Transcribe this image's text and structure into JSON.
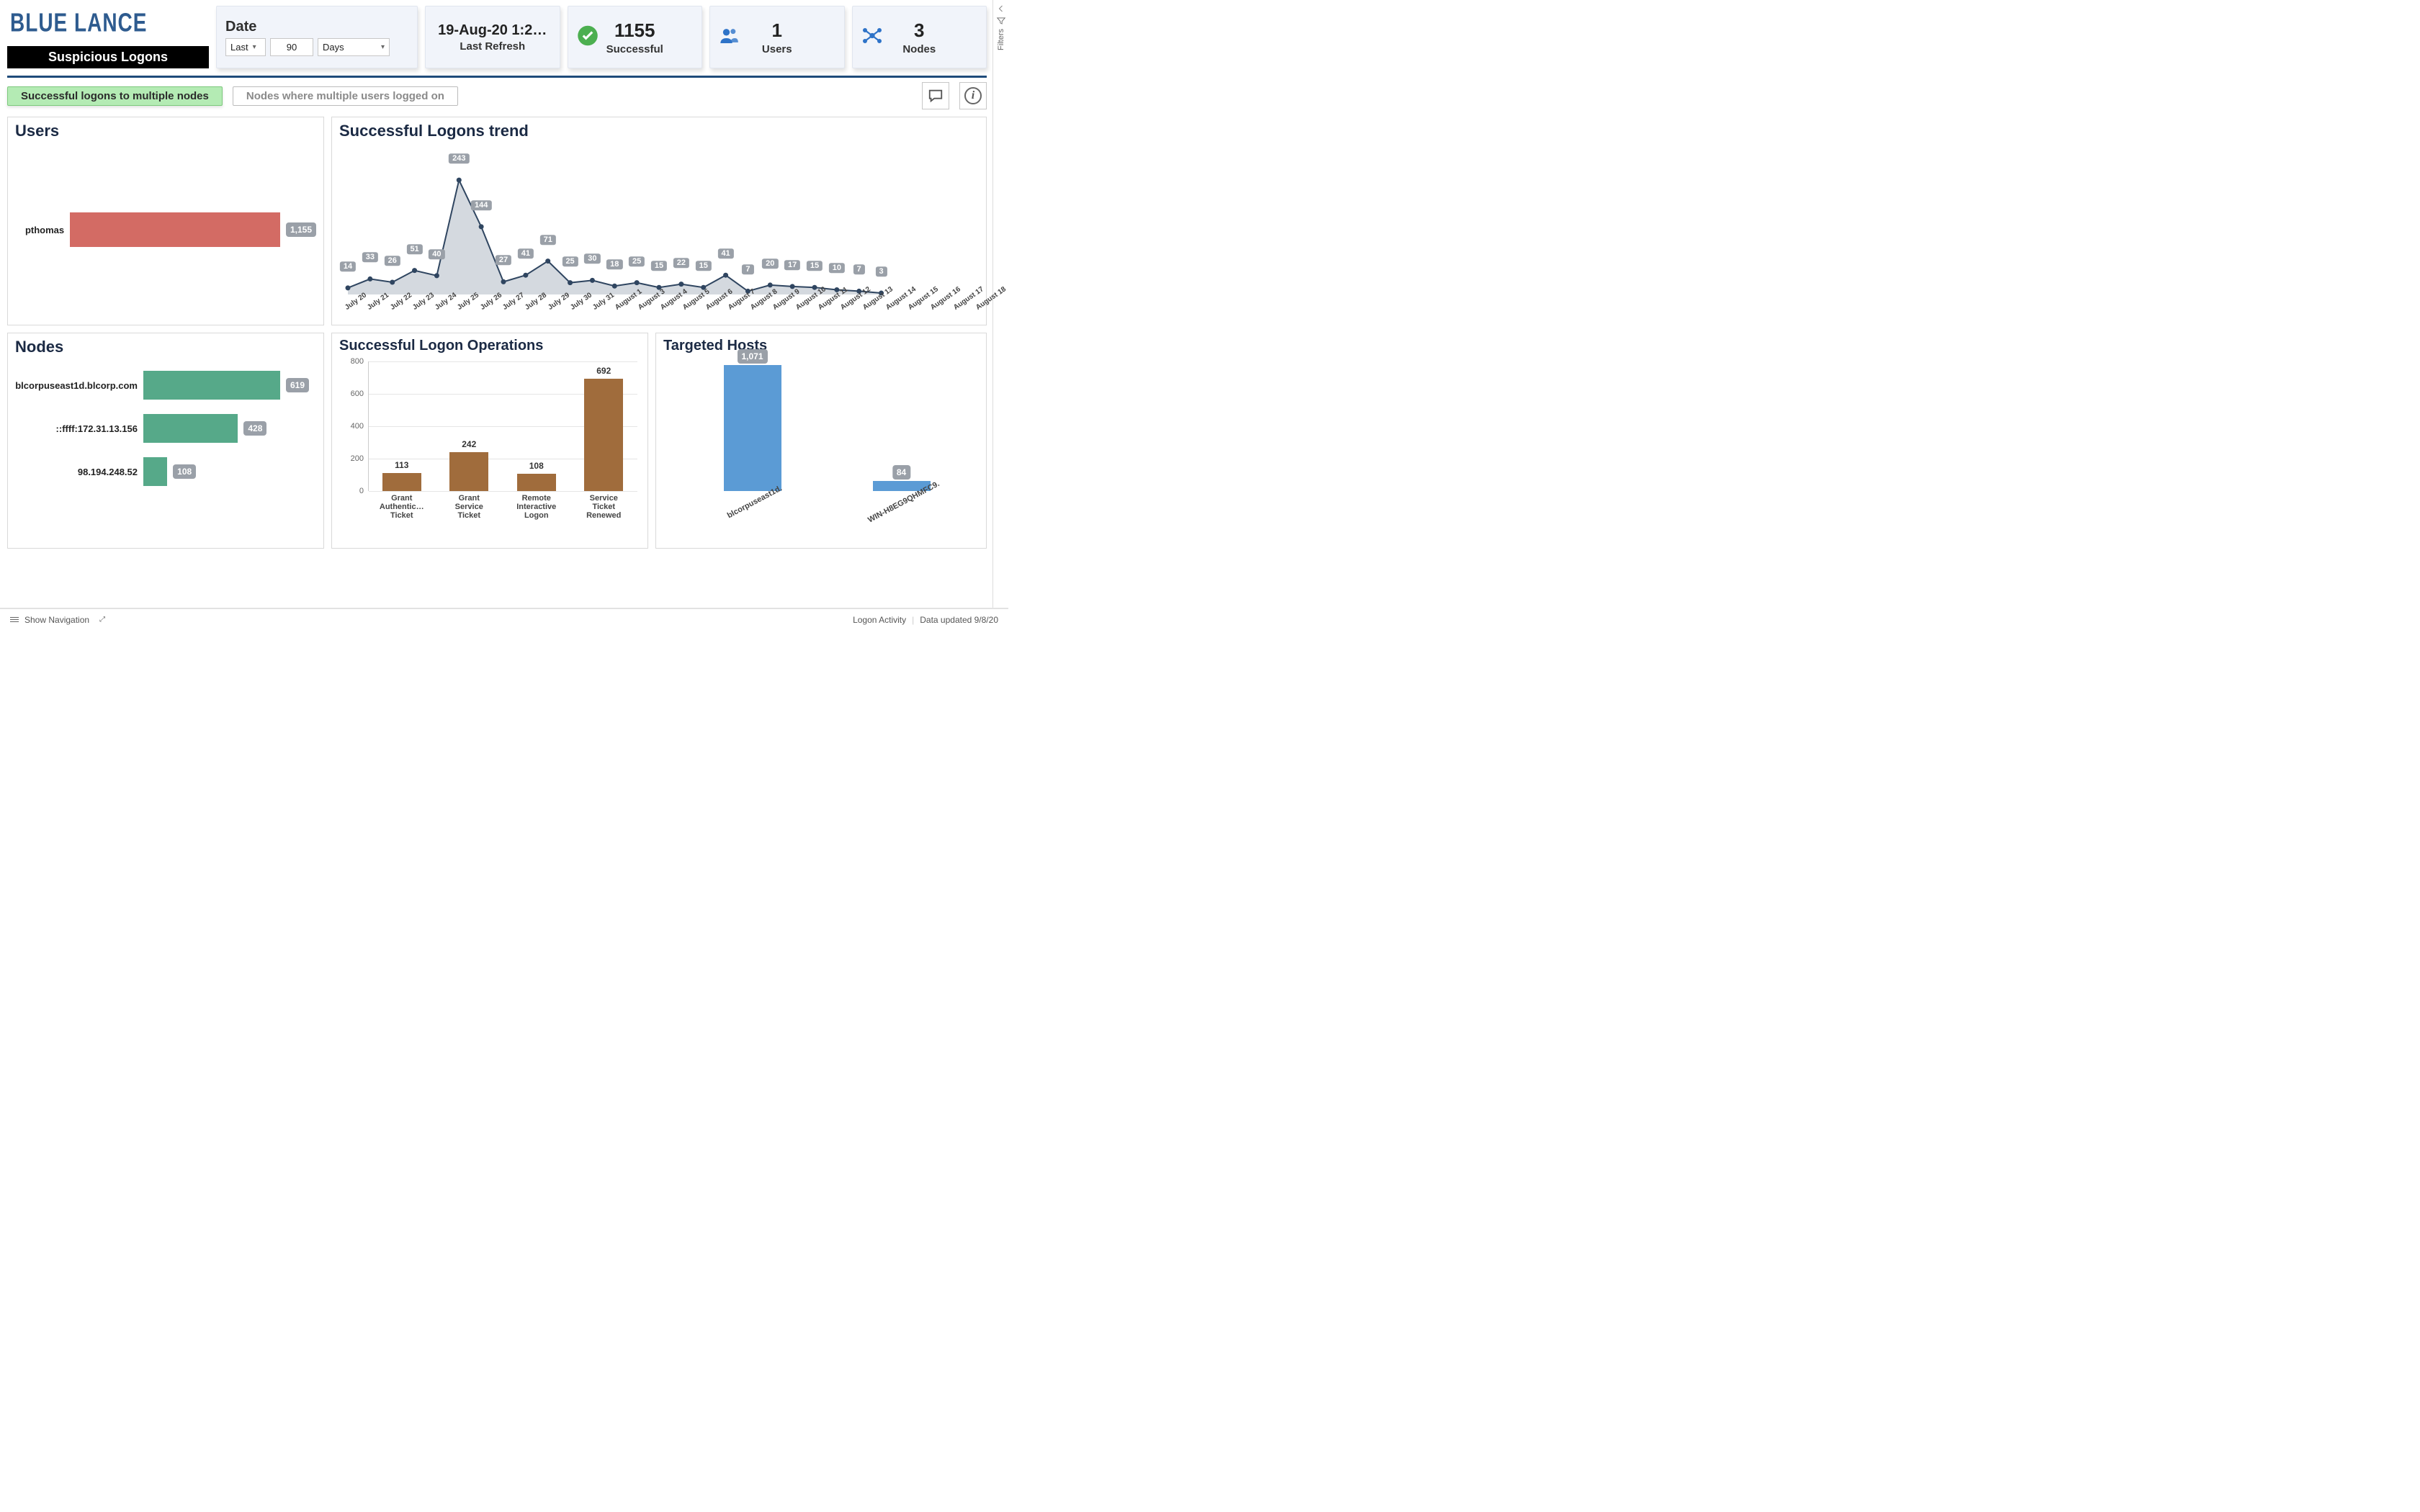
{
  "header": {
    "brand": "BLUE LANCE",
    "subtitle": "Suspicious Logons",
    "date_label": "Date",
    "range_mode": "Last",
    "range_value": "90",
    "range_unit": "Days",
    "refresh_value": "19-Aug-20 1:2…",
    "refresh_label": "Last Refresh",
    "kpi_success": {
      "value": "1155",
      "label": "Successful"
    },
    "kpi_users": {
      "value": "1",
      "label": "Users"
    },
    "kpi_nodes": {
      "value": "3",
      "label": "Nodes"
    }
  },
  "tabs": {
    "active": "Successful logons to multiple nodes",
    "inactive": "Nodes where multiple users logged on"
  },
  "panels": {
    "users_title": "Users",
    "nodes_title": "Nodes",
    "trend_title": "Successful Logons trend",
    "ops_title": "Successful Logon Operations",
    "hosts_title": "Targeted Hosts"
  },
  "filters_label": "Filters",
  "footer": {
    "show_nav": "Show Navigation",
    "right1": "Logon Activity",
    "right2": "Data updated 9/8/20"
  },
  "chart_data": [
    {
      "id": "users",
      "type": "bar",
      "orientation": "horizontal",
      "categories": [
        "pthomas"
      ],
      "values": [
        1155
      ],
      "value_labels": [
        "1,155"
      ],
      "color": "#d36b64"
    },
    {
      "id": "nodes",
      "type": "bar",
      "orientation": "horizontal",
      "categories": [
        "blcorpuseast1d.blcorp.com",
        "::ffff:172.31.13.156",
        "98.194.248.52"
      ],
      "values": [
        619,
        428,
        108
      ],
      "color": "#56a989"
    },
    {
      "id": "trend",
      "type": "area",
      "categories": [
        "July 20",
        "July 21",
        "July 22",
        "July 23",
        "July 24",
        "July 25",
        "July 26",
        "July 27",
        "July 28",
        "July 29",
        "July 30",
        "July 31",
        "August 1",
        "August 3",
        "August 4",
        "August 5",
        "August 6",
        "August 7",
        "August 8",
        "August 9",
        "August 10",
        "August 11",
        "August 12",
        "August 13",
        "August 14",
        "August 15",
        "August 16",
        "August 17",
        "August 18"
      ],
      "values": [
        14,
        33,
        26,
        51,
        40,
        243,
        144,
        27,
        41,
        71,
        25,
        30,
        18,
        25,
        15,
        22,
        15,
        41,
        7,
        20,
        17,
        15,
        10,
        7,
        3,
        0,
        0,
        0,
        0
      ],
      "labeled_values": [
        14,
        33,
        26,
        51,
        40,
        243,
        144,
        27,
        41,
        71,
        25,
        30,
        18,
        25,
        15,
        22,
        15,
        41,
        7,
        20,
        17,
        15,
        10,
        7,
        3
      ],
      "ylim": [
        0,
        260
      ],
      "title": "Successful Logons trend"
    },
    {
      "id": "ops",
      "type": "bar",
      "categories": [
        "Grant Authentic… Ticket",
        "Grant Service Ticket",
        "Remote Interactive Logon",
        "Service Ticket Renewed"
      ],
      "values": [
        113,
        242,
        108,
        692
      ],
      "ylim": [
        0,
        800
      ],
      "yticks": [
        0,
        200,
        400,
        600,
        800
      ],
      "color": "#a06c3c",
      "title": "Successful Logon Operations"
    },
    {
      "id": "hosts",
      "type": "bar",
      "categories": [
        "blcorpuseast1d.",
        "WIN-H8EG9QHMFC9."
      ],
      "values": [
        1071,
        84
      ],
      "value_labels": [
        "1,071",
        "84"
      ],
      "ylim": [
        0,
        1100
      ],
      "color": "#5b9bd5",
      "title": "Targeted Hosts"
    }
  ]
}
